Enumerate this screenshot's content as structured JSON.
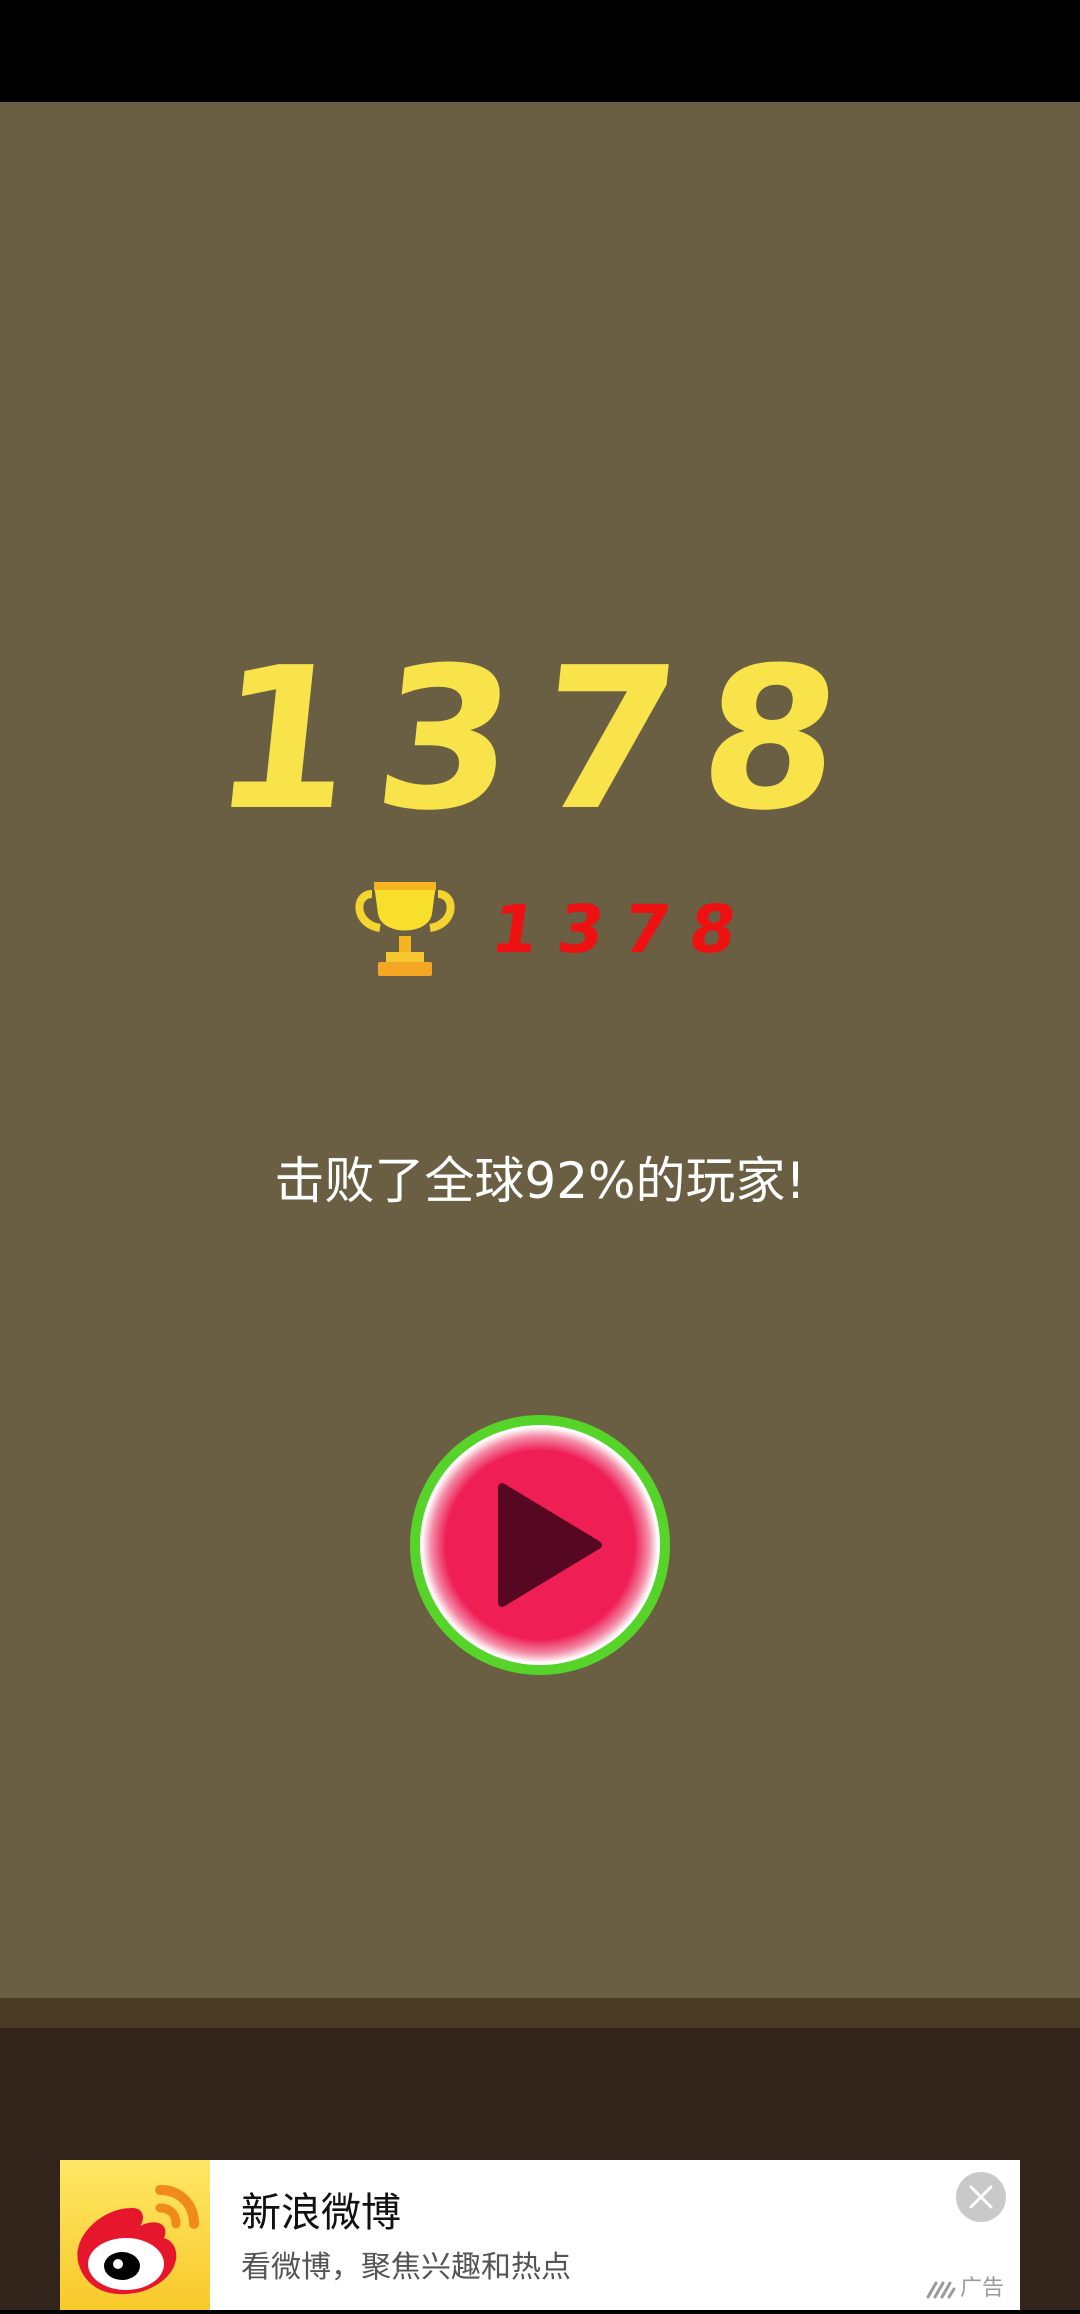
{
  "game": {
    "score": "1378",
    "best_score": "1378",
    "defeat_message": "击败了全球92%的玩家!",
    "play_icon": "play-icon",
    "trophy_icon": "trophy-icon"
  },
  "ad": {
    "title": "新浪微博",
    "subtitle": "看微博，聚焦兴趣和热点",
    "tag": "广告",
    "logo_icon": "weibo-logo-icon",
    "close_icon": "close-icon"
  },
  "colors": {
    "background": "#6a5f43",
    "ground": "#33241b",
    "score": "#f8e34a",
    "best_score": "#ee1111",
    "play_button_ring": "#57d42a",
    "play_button_fill": "#ef1e55"
  }
}
